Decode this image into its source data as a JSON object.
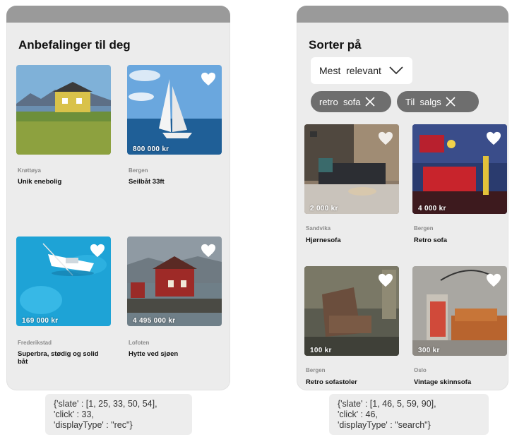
{
  "left_screen": {
    "title": "Anbefalinger til deg",
    "listings": [
      {
        "location": "Krøttøya",
        "name": "Unik enebolig",
        "price": ""
      },
      {
        "location": "Bergen",
        "name": "Seilbåt 33ft",
        "price": "800 000 kr"
      },
      {
        "location": "Frederikstad",
        "name": "Superbra,  stødig  og solid båt",
        "price": "169 000 kr"
      },
      {
        "location": "Lofoten",
        "name": "Hytte ved sjøen",
        "price": "4 495 000 kr"
      }
    ],
    "meta": {
      "line1": "{'slate' : [1, 25, 33, 50, 54],",
      "line2": "'click' : 33,",
      "line3": "'displayType' : \"rec\"}"
    }
  },
  "right_screen": {
    "title": "Sorter på",
    "sort": {
      "selected": "Mest  relevant"
    },
    "filters": [
      {
        "label": "retro  sofa"
      },
      {
        "label": "Til  salgs"
      }
    ],
    "listings": [
      {
        "location": "Sandvika",
        "name": "Hjørnesofa",
        "price": "2 000 kr"
      },
      {
        "location": "Bergen",
        "name": "Retro sofa",
        "price": "4 000 kr"
      },
      {
        "location": "Bergen",
        "name": "Retro sofastoler",
        "price": "100 kr"
      },
      {
        "location": "Oslo",
        "name": "Vintage  skinnsofa",
        "price": "300 kr"
      }
    ],
    "meta": {
      "line1": "{'slate' : [1, 46, 5, 59, 90],",
      "line2": "'click' : 46,",
      "line3": "'displayType' : \"search\"}"
    }
  },
  "icons": {
    "favorite": "heart-icon",
    "dropdown": "chevron-down-icon",
    "remove_filter": "close-icon"
  },
  "colors": {
    "topbar": "#9a9a9a",
    "screen_bg": "#ececec",
    "chip_bg": "#6e6e6e"
  }
}
